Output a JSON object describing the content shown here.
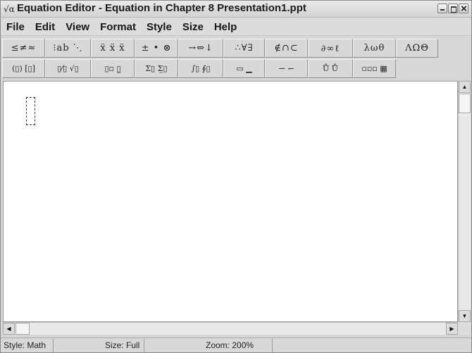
{
  "window": {
    "app_icon_glyph": "√α",
    "title": "Equation Editor - Equation in Chapter 8 Presentation1.ppt"
  },
  "menu": [
    "File",
    "Edit",
    "View",
    "Format",
    "Style",
    "Size",
    "Help"
  ],
  "toolbar_row1": [
    {
      "name": "relational-symbols",
      "glyph": "≤≠≈"
    },
    {
      "name": "spaces-ellipses",
      "glyph": "⁝ab ⋱"
    },
    {
      "name": "embellishments",
      "glyph": "ẍ ẍ ẍ"
    },
    {
      "name": "operator-symbols",
      "glyph": "± • ⊗"
    },
    {
      "name": "arrow-symbols",
      "glyph": "→⇔↓"
    },
    {
      "name": "logical-symbols",
      "glyph": "∴∀∃"
    },
    {
      "name": "set-theory-symbols",
      "glyph": "∉∩⊂"
    },
    {
      "name": "miscellaneous-symbols",
      "glyph": "∂∞ℓ"
    },
    {
      "name": "greek-lowercase",
      "glyph": "λωθ"
    },
    {
      "name": "greek-uppercase",
      "glyph": "ΛΩΘ"
    }
  ],
  "toolbar_row2": [
    {
      "name": "fence-templates",
      "glyph": "(▯) [▯]"
    },
    {
      "name": "fraction-radical-templates",
      "glyph": "▯⁄▯ √▯"
    },
    {
      "name": "subscript-superscript-templates",
      "glyph": "▯▫ ▯̲"
    },
    {
      "name": "summation-templates",
      "glyph": "Σ▯ Σ̲▯"
    },
    {
      "name": "integral-templates",
      "glyph": "∫▯ ∮▯"
    },
    {
      "name": "underbar-overbar-templates",
      "glyph": "▭ ▁"
    },
    {
      "name": "labeled-arrow-templates",
      "glyph": "⇀ ↽"
    },
    {
      "name": "products-set-theory-templates",
      "glyph": "Ů Ů"
    },
    {
      "name": "matrix-templates",
      "glyph": "▫▫▫ ▦"
    }
  ],
  "status": {
    "style": "Style: Math",
    "size": "Size: Full",
    "zoom": "Zoom: 200%"
  }
}
